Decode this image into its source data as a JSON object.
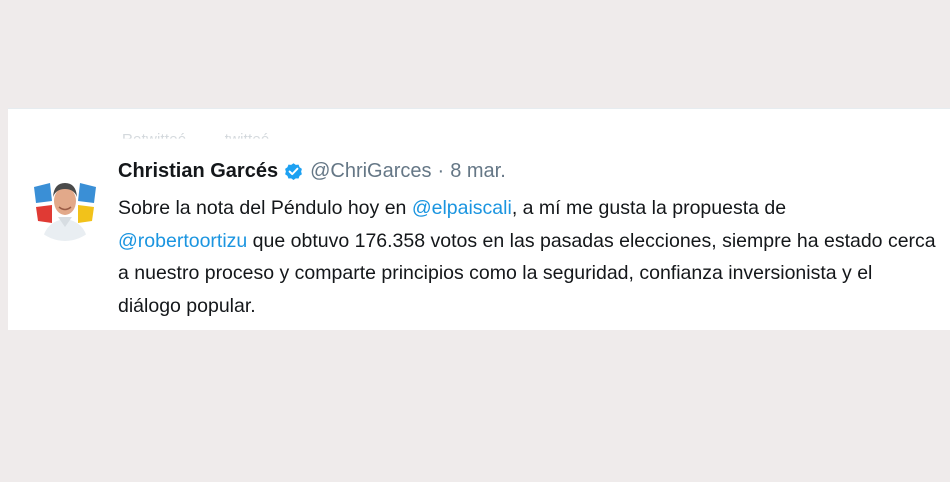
{
  "faded_header": {
    "retweeted_label": "Retwitteó",
    "retweeted_label_2": "twitteó"
  },
  "tweet": {
    "display_name": "Christian Garcés",
    "handle": "@ChriGarces",
    "separator": "·",
    "date": "8 mar.",
    "verified_icon": "verified-badge-icon",
    "text_segments": {
      "s1": "Sobre la nota del Péndulo hoy en ",
      "m1": "@elpaiscali",
      "s2": ", a mí me gusta la propuesta de ",
      "m2": "@robertoortizu",
      "s3": " que obtuvo 176.358 votos en las pasadas elecciones, siempre ha estado cerca a nuestro proceso y comparte principios como la seguridad, confianza inversionista y el diálogo popular."
    }
  },
  "colors": {
    "background": "#efebeb",
    "card": "#ffffff",
    "mention": "#1b95e0",
    "verified": "#1da1f2",
    "secondary_text": "#657786",
    "primary_text": "#14171a"
  }
}
